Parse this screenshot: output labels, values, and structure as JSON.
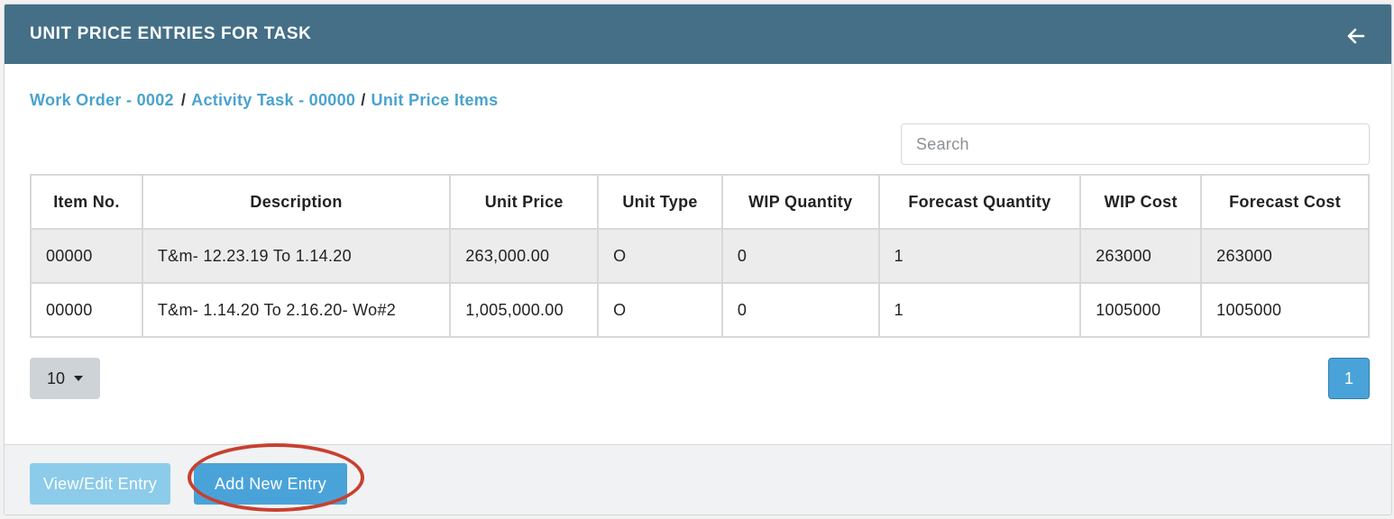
{
  "header": {
    "title": "UNIT PRICE ENTRIES FOR TASK"
  },
  "breadcrumb": {
    "work_order": "Work Order - 0002",
    "activity_task": "Activity Task - 00000",
    "current": "Unit Price Items",
    "separator": "/"
  },
  "search": {
    "placeholder": "Search",
    "value": ""
  },
  "table": {
    "columns": [
      "Item No.",
      "Description",
      "Unit Price",
      "Unit Type",
      "WIP Quantity",
      "Forecast Quantity",
      "WIP Cost",
      "Forecast Cost"
    ],
    "rows": [
      [
        "00000",
        "T&m- 12.23.19 To 1.14.20",
        "263,000.00",
        "O",
        "0",
        "1",
        "263000",
        "263000"
      ],
      [
        "00000",
        "T&m- 1.14.20 To 2.16.20- Wo#2",
        "1,005,000.00",
        "O",
        "0",
        "1",
        "1005000",
        "1005000"
      ]
    ]
  },
  "pagination": {
    "page_size": "10",
    "current_page": "1"
  },
  "footer": {
    "view_edit_label": "View/Edit Entry",
    "add_new_label": "Add New Entry"
  },
  "colors": {
    "header_bg": "#446f87",
    "link": "#4aa3cd",
    "primary_button": "#4aa3d8",
    "disabled_button": "#8ccbe9",
    "annotation": "#c8402f"
  },
  "icons": {
    "back": "arrow-left-icon",
    "page_size_caret": "caret-down-icon"
  }
}
